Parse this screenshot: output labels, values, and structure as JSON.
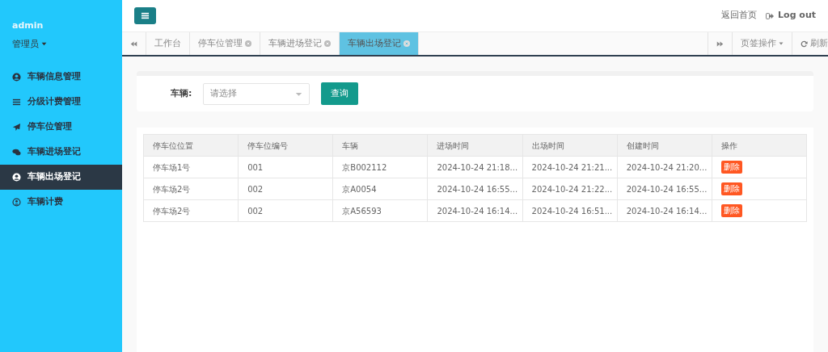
{
  "user": {
    "name": "admin",
    "role": "管理员"
  },
  "sidebar": {
    "items": [
      {
        "label": "车辆信息管理",
        "selected": false
      },
      {
        "label": "分级计费管理",
        "selected": false
      },
      {
        "label": "停车位管理",
        "selected": false
      },
      {
        "label": "车辆进场登记",
        "selected": false
      },
      {
        "label": "车辆出场登记",
        "selected": true
      },
      {
        "label": "车辆计费",
        "selected": false
      }
    ]
  },
  "header": {
    "home_link": "返回首页",
    "logout": "Log out"
  },
  "tabs": [
    {
      "label": "工作台",
      "selected": false,
      "closable": false
    },
    {
      "label": "停车位管理",
      "selected": false,
      "closable": true
    },
    {
      "label": "车辆进场登记",
      "selected": false,
      "closable": true
    },
    {
      "label": "车辆出场登记",
      "selected": true,
      "closable": true
    }
  ],
  "tab_actions": {
    "menu": "页签操作",
    "refresh": "刷新"
  },
  "search": {
    "label": "车辆:",
    "placeholder": "请选择",
    "button": "查询"
  },
  "table": {
    "columns": [
      "停车位位置",
      "停车位编号",
      "车辆",
      "进场时间",
      "出场时间",
      "创建时间",
      "操作"
    ],
    "rows": [
      {
        "cells": [
          "停车场1号",
          "001",
          "京B002112",
          "2024-10-24 21:18...",
          "2024-10-24 21:21...",
          "2024-10-24 21:20..."
        ],
        "action": "删除"
      },
      {
        "cells": [
          "停车场2号",
          "002",
          "京A0054",
          "2024-10-24 16:55...",
          "2024-10-24 21:22...",
          "2024-10-24 16:55..."
        ],
        "action": "删除"
      },
      {
        "cells": [
          "停车场2号",
          "002",
          "京A56593",
          "2024-10-24 16:14...",
          "2024-10-24 16:51...",
          "2024-10-24 16:14..."
        ],
        "action": "删除"
      }
    ]
  }
}
